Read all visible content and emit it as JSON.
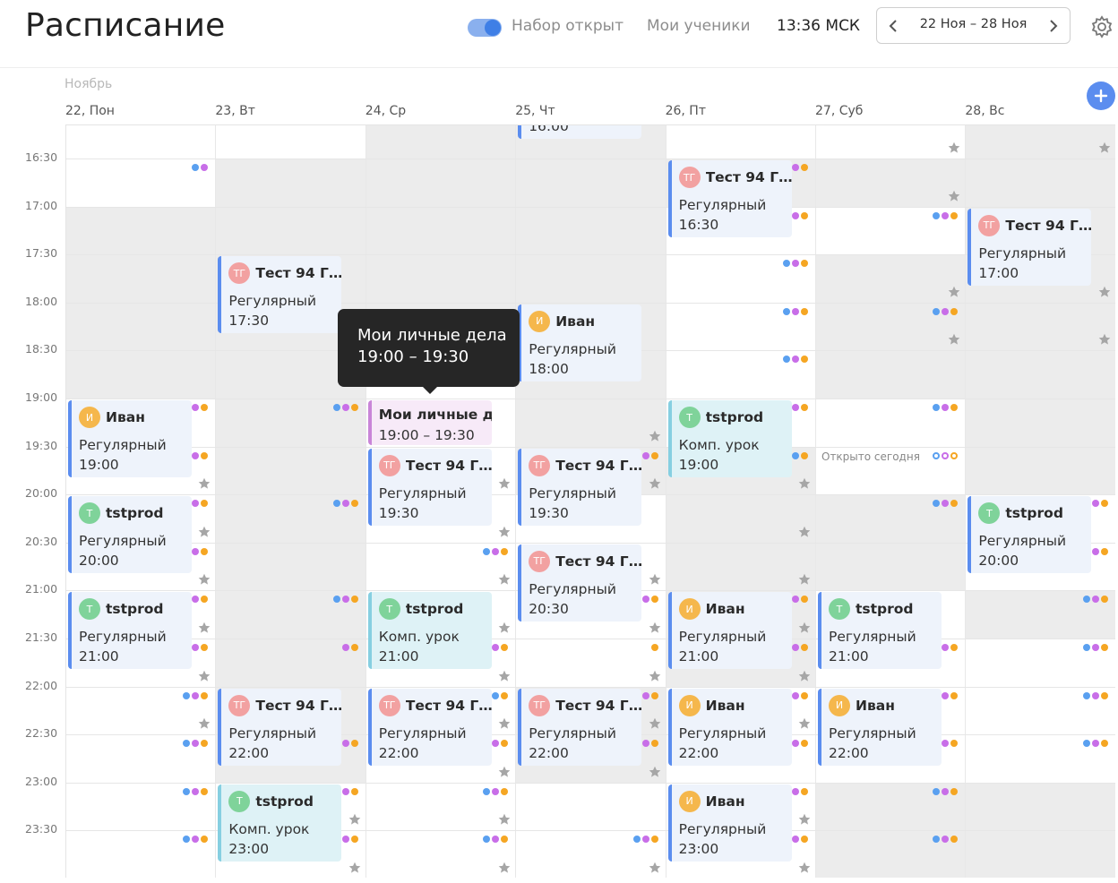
{
  "header": {
    "title": "Расписание",
    "toggle_label": "Набор открыт",
    "my_students": "Мои ученики",
    "time": "13:36 МСК",
    "range": "22 Ноя – 28 Ноя"
  },
  "calendar": {
    "month": "Ноябрь",
    "days": [
      "22, Пон",
      "23, Вт",
      "24, Ср",
      "25, Чт",
      "26, Пт",
      "27, Суб",
      "28, Вс"
    ],
    "times": [
      "16:30",
      "17:00",
      "17:30",
      "18:00",
      "18:30",
      "19:00",
      "19:30",
      "20:00",
      "20:30",
      "21:00",
      "21:30",
      "22:00",
      "22:30",
      "23:00",
      "23:30"
    ],
    "open_today": "Открыто сегодня"
  },
  "avatars": {
    "tg": "ТГ",
    "i": "И",
    "t": "Т"
  },
  "labels": {
    "regular": "Регулярный",
    "comp": "Комп. урок"
  },
  "names": {
    "test": "Тест 94 Гу...",
    "ivan": "Иван",
    "tstprod": "tstprod"
  },
  "event_times": {
    "t1600": "16:00",
    "t1630": "16:30",
    "t1700": "17:00",
    "t1730": "17:30",
    "t1800": "18:00",
    "t1900": "19:00",
    "t1930": "19:30",
    "t2000": "20:00",
    "t2030": "20:30",
    "t2100": "21:00",
    "t2200": "22:00",
    "t2300": "23:00"
  },
  "personal": {
    "title": "Мои личные де",
    "time": "19:00 – 19:30"
  },
  "tooltip": {
    "title": "Мои личные дела",
    "time": "19:00 – 19:30"
  },
  "colors": {
    "accent": "#5b8def",
    "dot_blue": "#5aa0f0",
    "dot_purple": "#c86ee8",
    "dot_orange": "#f5a623",
    "regular_border": "#5b8def",
    "comp_border": "#86cfe1",
    "personal_border": "#c985d8"
  }
}
